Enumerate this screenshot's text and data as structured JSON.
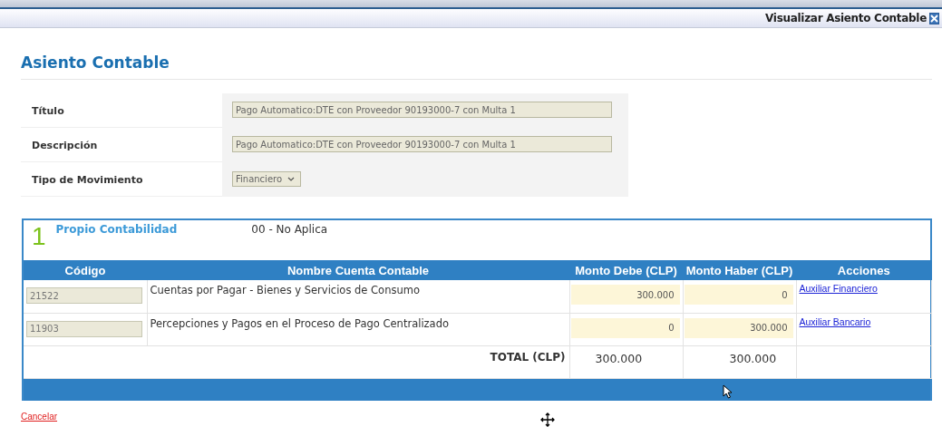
{
  "window": {
    "title": "Visualizar Asiento Contable"
  },
  "heading": "Asiento Contable",
  "form": [
    {
      "label": "Título",
      "kind": "text",
      "value": "Pago Automatico:DTE con Proveedor 90193000-7 con Multa 1"
    },
    {
      "label": "Descripción",
      "kind": "text",
      "value": "Pago Automatico:DTE con Proveedor 90193000-7 con Multa 1"
    },
    {
      "label": "Tipo de Movimiento",
      "kind": "select",
      "value": "Financiero"
    }
  ],
  "entry": {
    "number": "1",
    "title": "Propio Contabilidad",
    "subtitle": "00 - No Aplica",
    "columns": [
      "Código",
      "Nombre Cuenta Contable",
      "Monto Debe (CLP)",
      "Monto Haber (CLP)",
      "Acciones"
    ],
    "rows": [
      {
        "code": "21522",
        "name": "Cuentas por Pagar - Bienes y Servicios de Consumo",
        "debe": "300.000",
        "haber": "0",
        "action": "Auxiliar Financiero"
      },
      {
        "code": "11903",
        "name": "Percepciones y Pagos en el Proceso de Pago Centralizado",
        "debe": "0",
        "haber": "300.000",
        "action": "Auxiliar Bancario"
      }
    ],
    "total": {
      "label": "TOTAL (CLP)",
      "debe": "300.000",
      "haber": "300.000"
    }
  },
  "cancel": "Cancelar"
}
